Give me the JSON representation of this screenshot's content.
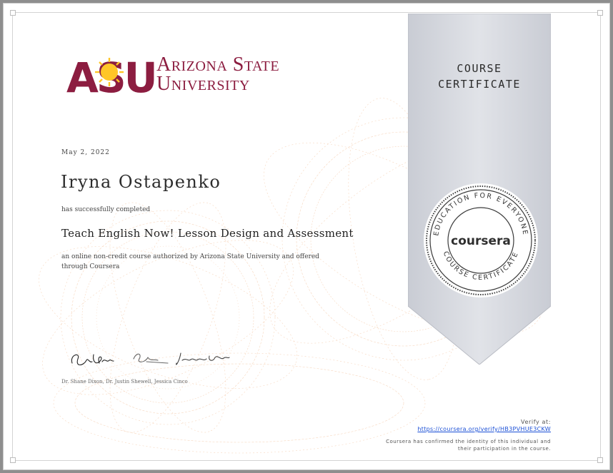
{
  "university": {
    "logo_text": "ASU",
    "name_line1": "Arizona State",
    "name_line2": "University"
  },
  "certificate": {
    "label_line1": "COURSE",
    "label_line2": "CERTIFICATE",
    "date": "May 2, 2022",
    "recipient": "Iryna Ostapenko",
    "completed_text": "has successfully completed",
    "course_title": "Teach English Now! Lesson Design and Assessment",
    "description": "an online non-credit course authorized by Arizona State University and offered through Coursera",
    "signers": "Dr. Shane Dixon, Dr. Justin Shewell, Jessica Cinco"
  },
  "seal": {
    "top_text": "EDUCATION FOR EVERYONE",
    "bottom_text": "COURSE CERTIFICATE",
    "brand": "coursera"
  },
  "verification": {
    "label": "Verify at:",
    "url": "https://coursera.org/verify/HB3PVHUE3CKW",
    "confirm_line1": "Coursera has confirmed the identity of this individual and",
    "confirm_line2": "their participation in the course."
  },
  "colors": {
    "asu_maroon": "#8c1d40",
    "asu_gold": "#ffc627",
    "ribbon": "#d6d9e0",
    "guilloche": "#f6d3b8"
  }
}
